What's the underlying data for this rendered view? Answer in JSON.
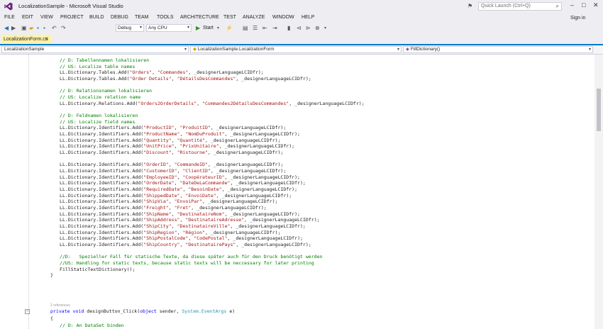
{
  "window": {
    "title": "LocalizationSample - Microsoft Visual Studio",
    "quick_launch_placeholder": "Quick Launch (Ctrl+Q)",
    "sign_in": "Sign in"
  },
  "menu": [
    "FILE",
    "EDIT",
    "VIEW",
    "PROJECT",
    "BUILD",
    "DEBUG",
    "TEAM",
    "TOOLS",
    "ARCHITECTURE",
    "TEST",
    "ANALYZE",
    "WINDOW",
    "HELP"
  ],
  "toolbar": {
    "configuration": "Debug",
    "platform": "Any CPU",
    "start": "Start"
  },
  "tab": {
    "label": "LocalizationForm.cs"
  },
  "navbar": {
    "project": "LocalizationSample",
    "class": "LocalizationSample.LocalizationForm",
    "member": "FillDictionary()"
  },
  "code_lines": [
    [
      [
        "    ",
        ""
      ],
      [
        "// D: Tabellennamen lokalisieren",
        "cm"
      ]
    ],
    [
      [
        "    ",
        ""
      ],
      [
        "// US: Localize table names",
        "cm"
      ]
    ],
    [
      [
        "    LL.Dictionary.Tables.Add(",
        ""
      ],
      [
        "\"Orders\"",
        "st"
      ],
      [
        ", ",
        ""
      ],
      [
        "\"Commandes\"",
        "st"
      ],
      [
        ", _designerLanguageLCIDfr);",
        ""
      ]
    ],
    [
      [
        "    LL.Dictionary.Tables.Add(",
        ""
      ],
      [
        "\"Order Details\"",
        "st"
      ],
      [
        ", ",
        ""
      ],
      [
        "\"DétailsDesCommandes\"",
        "st"
      ],
      [
        ", _designerLanguageLCIDfr);",
        ""
      ]
    ],
    [
      [
        "",
        ""
      ]
    ],
    [
      [
        "    ",
        ""
      ],
      [
        "// D: Relationsnamen lokalisieren",
        "cm"
      ]
    ],
    [
      [
        "    ",
        ""
      ],
      [
        "// US: Localize relation name",
        "cm"
      ]
    ],
    [
      [
        "    LL.Dictionary.Relations.Add(",
        ""
      ],
      [
        "\"Orders2OrderDetails\"",
        "st"
      ],
      [
        ", ",
        ""
      ],
      [
        "\"Commandes2DétailsDesCommandes\"",
        "st"
      ],
      [
        ", _designerLanguageLCIDfr);",
        ""
      ]
    ],
    [
      [
        "",
        ""
      ]
    ],
    [
      [
        "    ",
        ""
      ],
      [
        "// D: Feldnamen lokalisieren",
        "cm"
      ]
    ],
    [
      [
        "    ",
        ""
      ],
      [
        "// US: Localize field names",
        "cm"
      ]
    ],
    [
      [
        "    LL.Dictionary.Identifiers.Add(",
        ""
      ],
      [
        "\"ProductID\"",
        "st"
      ],
      [
        ", ",
        ""
      ],
      [
        "\"ProduitID\"",
        "st"
      ],
      [
        ", _designerLanguageLCIDfr);",
        ""
      ]
    ],
    [
      [
        "    LL.Dictionary.Identifiers.Add(",
        ""
      ],
      [
        "\"ProductName\"",
        "st"
      ],
      [
        ", ",
        ""
      ],
      [
        "\"NomDuProduit\"",
        "st"
      ],
      [
        ", _designerLanguageLCIDfr);",
        ""
      ]
    ],
    [
      [
        "    LL.Dictionary.Identifiers.Add(",
        ""
      ],
      [
        "\"Quantity\"",
        "st"
      ],
      [
        ", ",
        ""
      ],
      [
        "\"Quantité\"",
        "st"
      ],
      [
        ", _designerLanguageLCIDfr);",
        ""
      ]
    ],
    [
      [
        "    LL.Dictionary.Identifiers.Add(",
        ""
      ],
      [
        "\"UnitPrice\"",
        "st"
      ],
      [
        ", ",
        ""
      ],
      [
        "\"PrixUnitaire\"",
        "st"
      ],
      [
        ", _designerLanguageLCIDfr);",
        ""
      ]
    ],
    [
      [
        "    LL.Dictionary.Identifiers.Add(",
        ""
      ],
      [
        "\"Discount\"",
        "st"
      ],
      [
        ", ",
        ""
      ],
      [
        "\"Ristourne\"",
        "st"
      ],
      [
        ", _designerLanguageLCIDfr);",
        ""
      ]
    ],
    [
      [
        "",
        ""
      ]
    ],
    [
      [
        "    LL.Dictionary.Identifiers.Add(",
        ""
      ],
      [
        "\"OrderID\"",
        "st"
      ],
      [
        ", ",
        ""
      ],
      [
        "\"CommandeID\"",
        "st"
      ],
      [
        ", _designerLanguageLCIDfr);",
        ""
      ]
    ],
    [
      [
        "    LL.Dictionary.Identifiers.Add(",
        ""
      ],
      [
        "\"CustomerID\"",
        "st"
      ],
      [
        ", ",
        ""
      ],
      [
        "\"ClientID\"",
        "st"
      ],
      [
        ", _designerLanguageLCIDfr);",
        ""
      ]
    ],
    [
      [
        "    LL.Dictionary.Identifiers.Add(",
        ""
      ],
      [
        "\"EmployeeID\"",
        "st"
      ],
      [
        ", ",
        ""
      ],
      [
        "\"CoopérateurID\"",
        "st"
      ],
      [
        ", _designerLanguageLCIDfr);",
        ""
      ]
    ],
    [
      [
        "    LL.Dictionary.Identifiers.Add(",
        ""
      ],
      [
        "\"OrderDate\"",
        "st"
      ],
      [
        ", ",
        ""
      ],
      [
        "\"DateDeLaCommande\"",
        "st"
      ],
      [
        ", _designerLanguageLCIDfr);",
        ""
      ]
    ],
    [
      [
        "    LL.Dictionary.Identifiers.Add(",
        ""
      ],
      [
        "\"RequiredDate\"",
        "st"
      ],
      [
        ", ",
        ""
      ],
      [
        "\"BesoinDate\"",
        "st"
      ],
      [
        ", _designerLanguageLCIDfr);",
        ""
      ]
    ],
    [
      [
        "    LL.Dictionary.Identifiers.Add(",
        ""
      ],
      [
        "\"ShippedDate\"",
        "st"
      ],
      [
        ", ",
        ""
      ],
      [
        "\"EnvoiDate\"",
        "st"
      ],
      [
        ", _designerLanguageLCIDfr);",
        ""
      ]
    ],
    [
      [
        "    LL.Dictionary.Identifiers.Add(",
        ""
      ],
      [
        "\"ShipVia\"",
        "st"
      ],
      [
        ", ",
        ""
      ],
      [
        "\"EnvoiPar\"",
        "st"
      ],
      [
        ", _designerLanguageLCIDfr);",
        ""
      ]
    ],
    [
      [
        "    LL.Dictionary.Identifiers.Add(",
        ""
      ],
      [
        "\"Freight\"",
        "st"
      ],
      [
        ", ",
        ""
      ],
      [
        "\"Fret\"",
        "st"
      ],
      [
        ", _designerLanguageLCIDfr);",
        ""
      ]
    ],
    [
      [
        "    LL.Dictionary.Identifiers.Add(",
        ""
      ],
      [
        "\"ShipName\"",
        "st"
      ],
      [
        ", ",
        ""
      ],
      [
        "\"DestinataireNom\"",
        "st"
      ],
      [
        ", _designerLanguageLCIDfr);",
        ""
      ]
    ],
    [
      [
        "    LL.Dictionary.Identifiers.Add(",
        ""
      ],
      [
        "\"ShipAddress\"",
        "st"
      ],
      [
        ", ",
        ""
      ],
      [
        "\"DestinataireAdresse\"",
        "st"
      ],
      [
        ", _designerLanguageLCIDfr);",
        ""
      ]
    ],
    [
      [
        "    LL.Dictionary.Identifiers.Add(",
        ""
      ],
      [
        "\"ShipCity\"",
        "st"
      ],
      [
        ", ",
        ""
      ],
      [
        "\"DestinataireVille\"",
        "st"
      ],
      [
        ", _designerLanguageLCIDfr);",
        ""
      ]
    ],
    [
      [
        "    LL.Dictionary.Identifiers.Add(",
        ""
      ],
      [
        "\"ShipRegion\"",
        "st"
      ],
      [
        ", ",
        ""
      ],
      [
        "\"Région\"",
        "st"
      ],
      [
        ", _designerLanguageLCIDfr);",
        ""
      ]
    ],
    [
      [
        "    LL.Dictionary.Identifiers.Add(",
        ""
      ],
      [
        "\"ShipPostalCode\"",
        "st"
      ],
      [
        ", ",
        ""
      ],
      [
        "\"CodePostal\"",
        "st"
      ],
      [
        ", _designerLanguageLCIDfr);",
        ""
      ]
    ],
    [
      [
        "    LL.Dictionary.Identifiers.Add(",
        ""
      ],
      [
        "\"ShipCountry\"",
        "st"
      ],
      [
        ", ",
        ""
      ],
      [
        "\"DestinatairePays\"",
        "st"
      ],
      [
        ", _designerLanguageLCIDfr);",
        ""
      ]
    ],
    [
      [
        "",
        ""
      ]
    ],
    [
      [
        "    ",
        ""
      ],
      [
        "//D:   Spezieller Fall für statische Texte, da diese später auch für den Druck benötigt werden",
        "cm"
      ]
    ],
    [
      [
        "    ",
        ""
      ],
      [
        "//US: Handling for static texts, because static texts will be neccessary for later printing",
        "cm"
      ]
    ],
    [
      [
        "    FillStaticTextDictionary();",
        ""
      ]
    ],
    [
      [
        "}",
        ""
      ]
    ],
    [
      [
        "",
        ""
      ]
    ],
    [
      [
        "",
        ""
      ],
      [
        "private",
        "kw"
      ],
      [
        " ",
        ""
      ],
      [
        "void",
        "kw"
      ],
      [
        " designButton_Click(",
        ""
      ],
      [
        "object",
        "kw"
      ],
      [
        " sender, ",
        ""
      ],
      [
        "System.EventArgs",
        "ty"
      ],
      [
        " e)",
        ""
      ]
    ],
    [
      [
        "{",
        ""
      ]
    ],
    [
      [
        "    ",
        ""
      ],
      [
        "// D: An DataSet binden",
        "cm"
      ]
    ]
  ],
  "references_label": "2 references"
}
